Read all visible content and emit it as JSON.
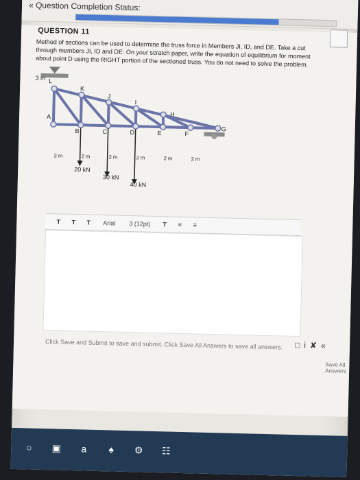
{
  "header": {
    "status_title": "« Question Completion Status:",
    "progress": 0.78
  },
  "question": {
    "title": "QUESTION 11",
    "text": "Method of sections can be used to determine the truss force in Members JI, ID, and DE. Take a cut through members JI, ID and DE. On your scratch paper, write the equation of equilibrium for moment about point D using the RIGHT portion of the sectioned truss. You do not need to solve the problem."
  },
  "truss": {
    "height_label": "3 m",
    "node_labels": {
      "L": "L",
      "K": "K",
      "J": "J",
      "I": "I",
      "H": "H",
      "A": "A",
      "B": "B",
      "C": "C",
      "D": "D",
      "E": "E",
      "F": "F",
      "G": "G"
    },
    "spacing_labels": [
      "2 m",
      "2 m",
      "2 m",
      "2 m",
      "2 m",
      "2 m"
    ],
    "load_labels": [
      "20 kN",
      "30 kN",
      "40 kN"
    ]
  },
  "editor": {
    "toolbar": {
      "btn_t1": "T",
      "btn_t2": "T",
      "btn_t3": "T",
      "font": "Arial",
      "size": "3 (12pt)",
      "format_t": "T",
      "list1": "≡",
      "list2": "≡"
    }
  },
  "footer": {
    "help_text": "Click Save and Submit to save and submit. Click Save All Answers to save all answers.",
    "save_all": "Save All Answers",
    "tools": [
      "□",
      "i",
      "✘",
      "«"
    ]
  },
  "taskbar": {
    "icons": [
      "○",
      "▣",
      "a",
      "♠",
      "⚙",
      "☷"
    ]
  },
  "colors": {
    "accent": "#4a7bd1",
    "truss": "#6b74a8",
    "taskbar": "#233a55"
  }
}
